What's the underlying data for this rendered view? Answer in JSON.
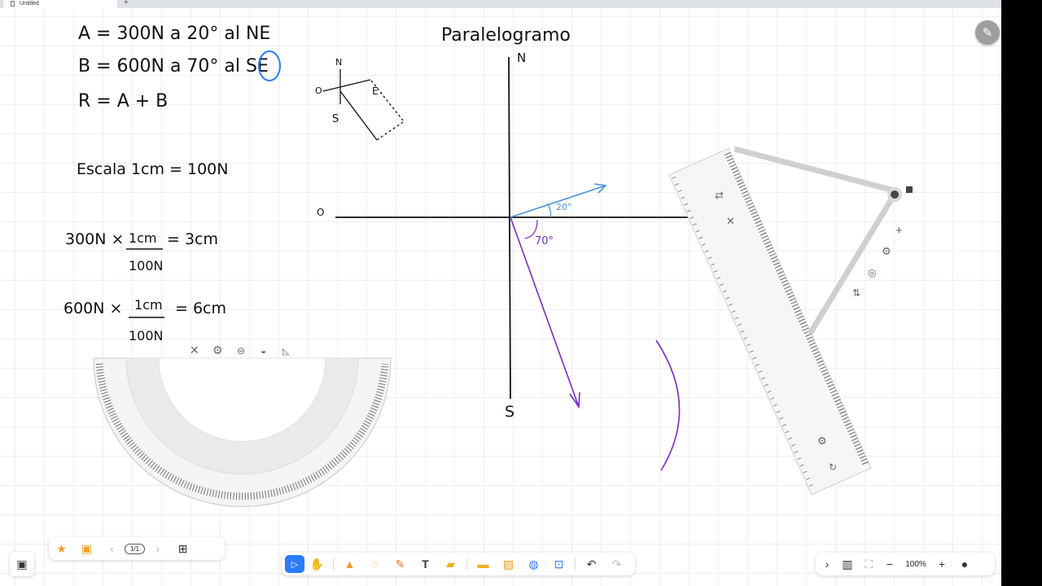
{
  "tab": {
    "title": "Untitled"
  },
  "notes": {
    "eq_a": "A = 300N a 20° al NE",
    "eq_b": "B = 600N a 70° al SE",
    "eq_r": "R = A + B",
    "scale": "Escala  1cm = 100N",
    "calc1_left": "300N ×",
    "calc1_num": "1cm",
    "calc1_den": "100N",
    "calc1_result": "= 3cm",
    "calc2_left": "600N ×",
    "calc2_num": "1cm",
    "calc2_den": "100N",
    "calc2_result": "= 6cm"
  },
  "diagram": {
    "title": "Paralelogramo",
    "north": "N",
    "south": "S",
    "west": "O",
    "angle_a": "20°",
    "angle_b": "70°",
    "sketch_n": "N",
    "sketch_s": "S",
    "sketch_o": "O",
    "sketch_e": "E"
  },
  "bottom_toolbar": {
    "page_counter": "1/1",
    "zoom": "100%"
  },
  "colors": {
    "vector_a": "#4a90d9",
    "vector_b": "#7b2cbf",
    "accent": "#2b7cff"
  },
  "icons": [
    "pen-icon",
    "close-icon",
    "gear-icon",
    "pointer-icon",
    "hand-icon",
    "marker-icon",
    "shape-icon",
    "pen-tool-icon",
    "text-icon",
    "sticky-note-icon",
    "folder-icon",
    "image-icon",
    "globe-icon",
    "screenshot-icon",
    "undo-icon",
    "redo-icon",
    "map-icon",
    "fit-icon",
    "zoom-out-icon",
    "zoom-in-icon",
    "user-icon"
  ]
}
